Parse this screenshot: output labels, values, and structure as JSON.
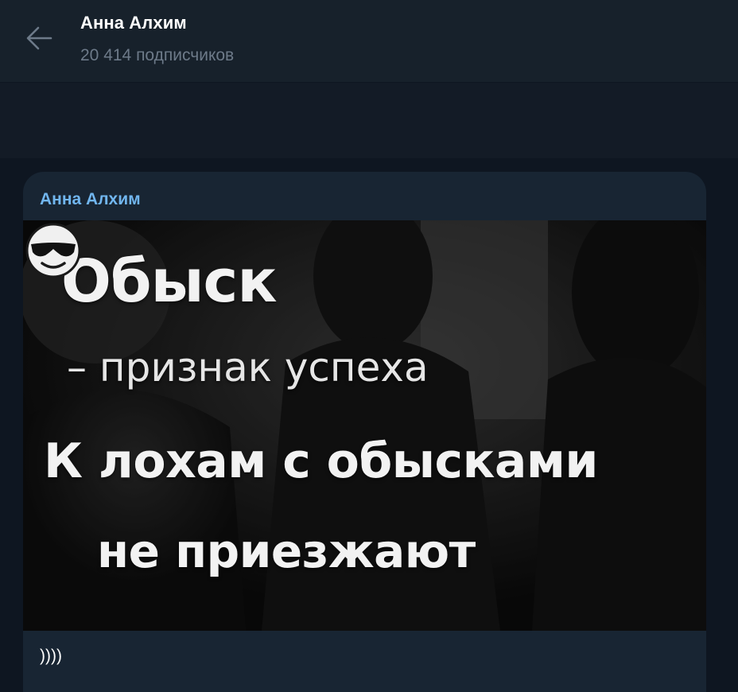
{
  "header": {
    "title": "Анна Алхим",
    "subscribers": "20 414 подписчиков",
    "back_icon": "arrow-left-icon"
  },
  "post": {
    "author": "Анна Алхим",
    "photo": {
      "line1": "Обыск",
      "line2": "– признак успеха",
      "line3": "К лохам с обысками",
      "line4": "не приезжают",
      "emoji": "smiling-face-with-sunglasses-icon"
    },
    "caption": "))))"
  },
  "colors": {
    "header_bg": "#17212b",
    "feed_bg": "#0e1621",
    "bubble_bg": "#182533",
    "author_accent": "#71b6ef",
    "subtitle_gray": "#6d7a89"
  }
}
